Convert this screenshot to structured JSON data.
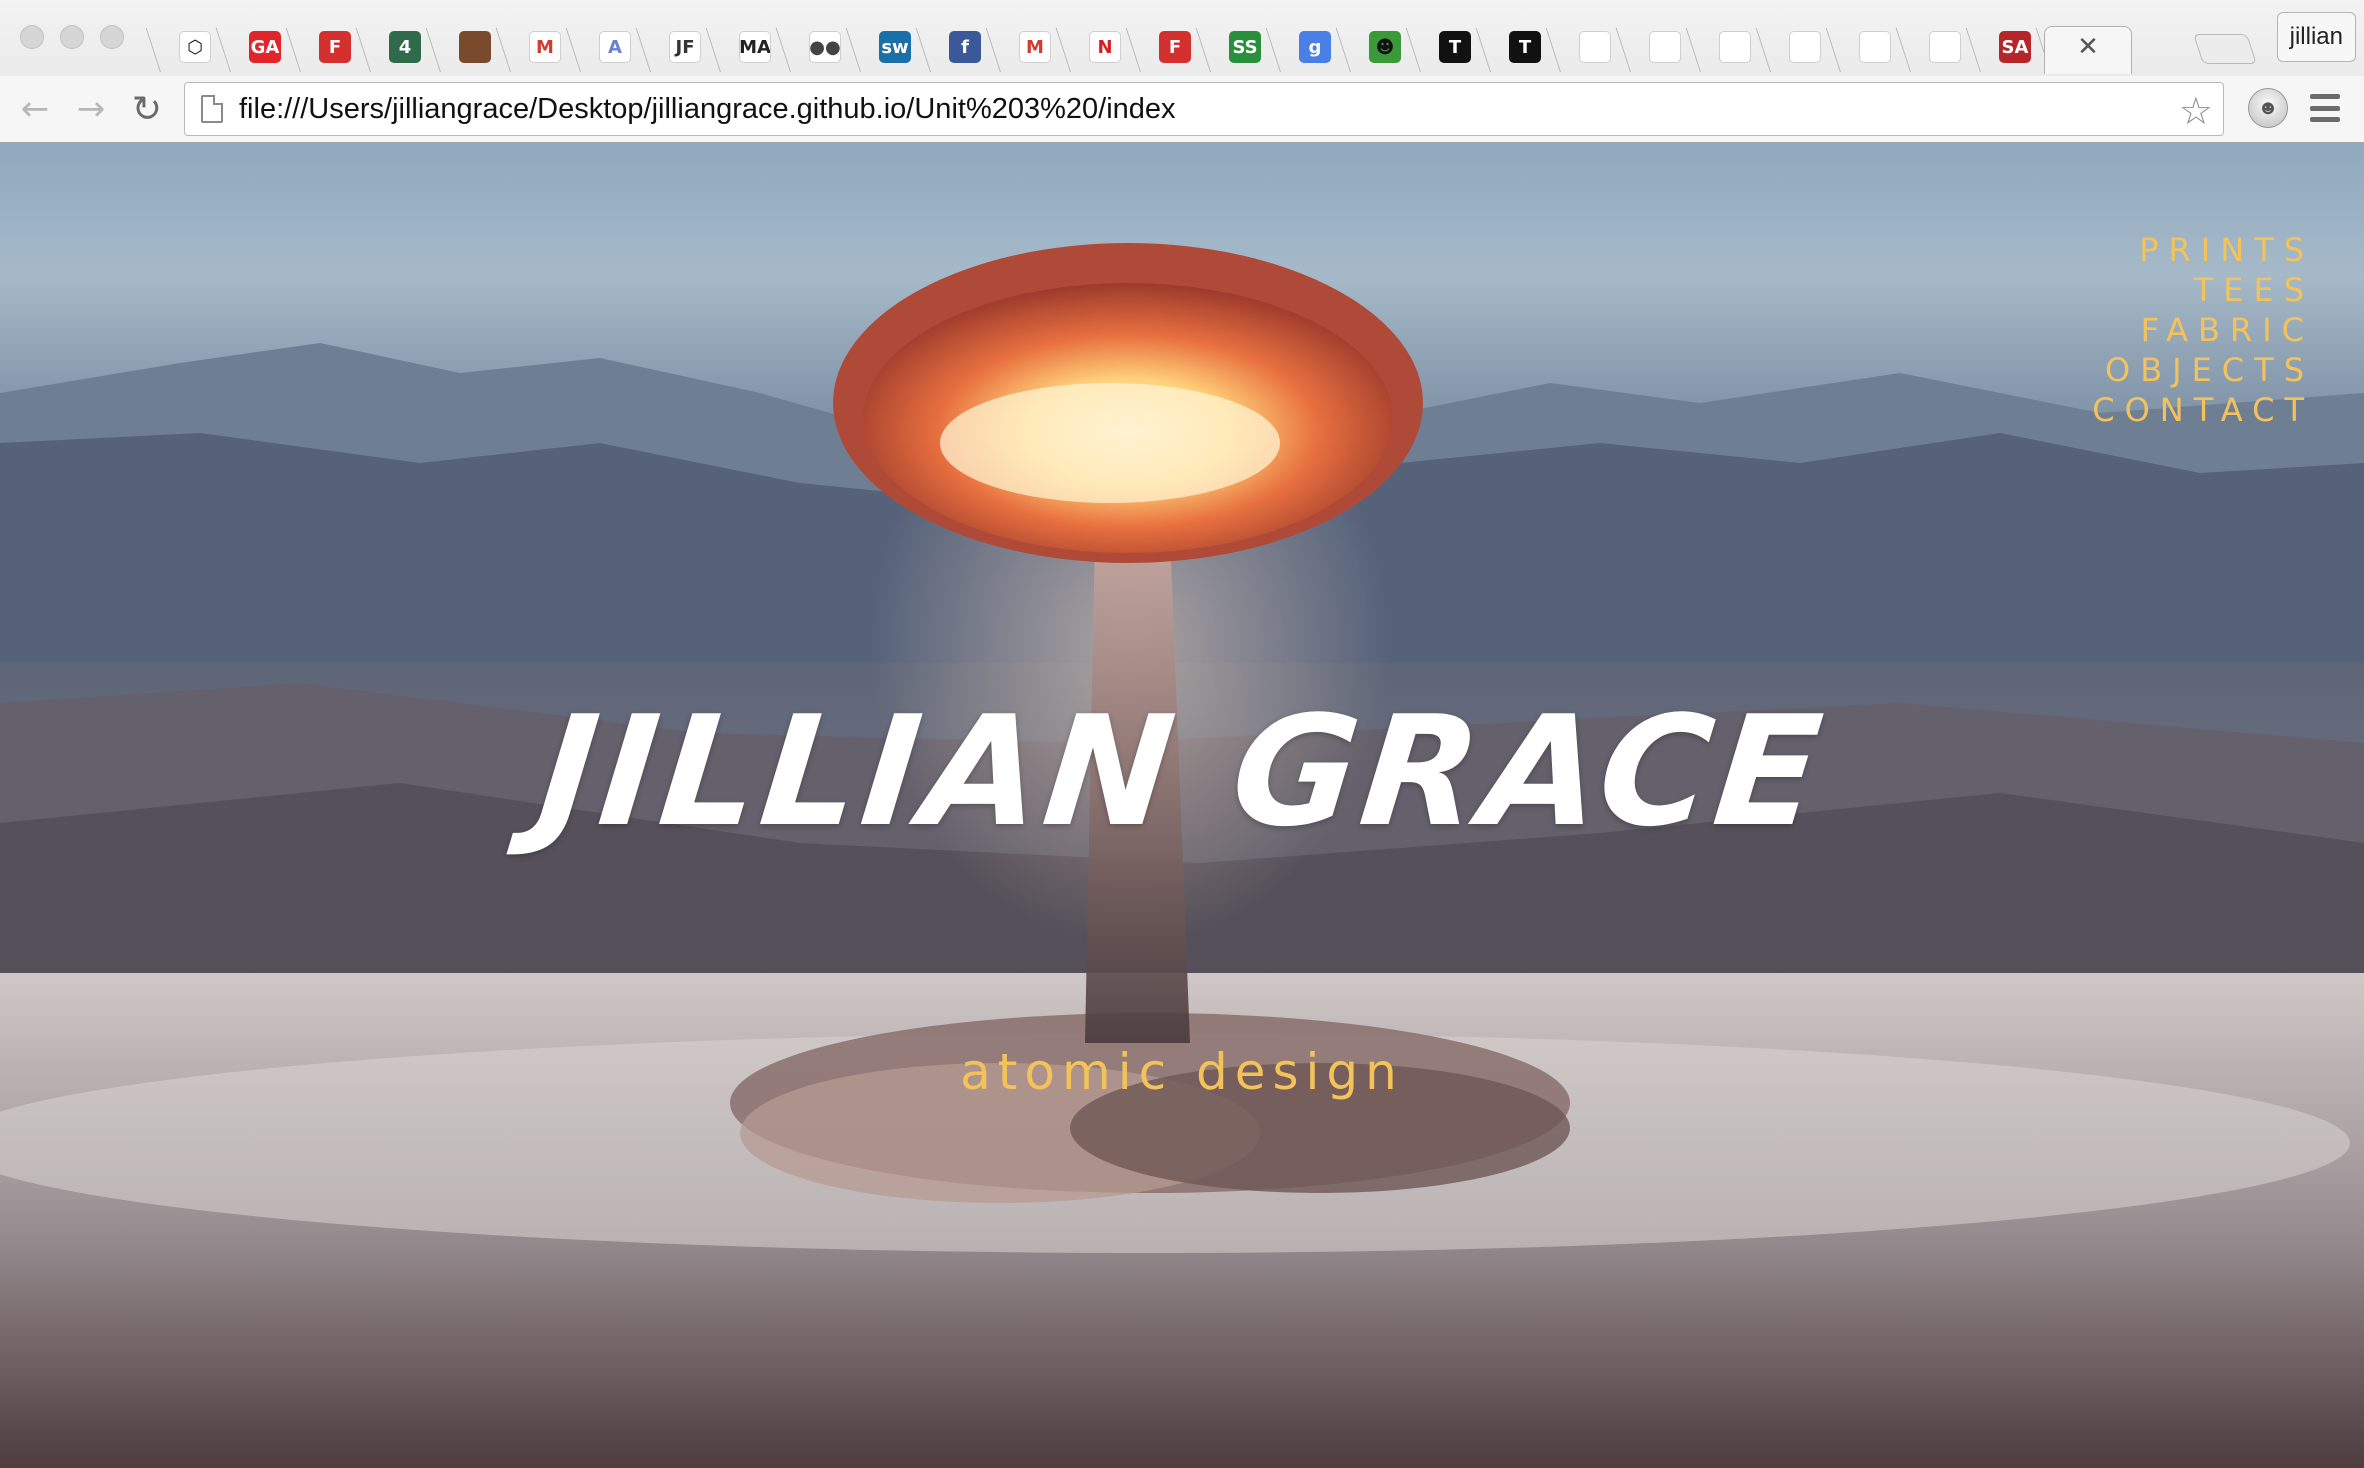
{
  "browser": {
    "tabs": [
      {
        "icon": "codepen-icon",
        "glyph": "⬡",
        "bg": "#ffffff",
        "fg": "#111111"
      },
      {
        "icon": "general-assembly-icon",
        "glyph": "GA",
        "bg": "#e0262b",
        "fg": "#ffffff"
      },
      {
        "icon": "fiveby-icon",
        "glyph": "F",
        "bg": "#d4302f",
        "fg": "#ffffff"
      },
      {
        "icon": "channel4-icon",
        "glyph": "4",
        "bg": "#2f6b4a",
        "fg": "#ffffff"
      },
      {
        "icon": "portrait-icon",
        "glyph": "",
        "bg": "#7a4a2c",
        "fg": "#ffffff"
      },
      {
        "icon": "gmail-icon",
        "glyph": "M",
        "bg": "#ffffff",
        "fg": "#d23b2f"
      },
      {
        "icon": "font-a-icon",
        "glyph": "A",
        "bg": "#ffffff",
        "fg": "#6b7fd6"
      },
      {
        "icon": "jf-icon",
        "glyph": "JF",
        "bg": "#ffffff",
        "fg": "#333333"
      },
      {
        "icon": "ma-icon",
        "glyph": "MA",
        "bg": "#ffffff",
        "fg": "#222222"
      },
      {
        "icon": "circles-icon",
        "glyph": "●●",
        "bg": "#ffffff",
        "fg": "#444444"
      },
      {
        "icon": "sw-icon",
        "glyph": "sw",
        "bg": "#1a6fa8",
        "fg": "#ffffff"
      },
      {
        "icon": "facebook-icon",
        "glyph": "f",
        "bg": "#3b5998",
        "fg": "#ffffff"
      },
      {
        "icon": "gmail-icon",
        "glyph": "M",
        "bg": "#ffffff",
        "fg": "#d23b2f"
      },
      {
        "icon": "netflix-icon",
        "glyph": "N",
        "bg": "#ffffff",
        "fg": "#d81f26"
      },
      {
        "icon": "fiveby-icon",
        "glyph": "F",
        "bg": "#d4302f",
        "fg": "#ffffff"
      },
      {
        "icon": "ss-icon",
        "glyph": "SS",
        "bg": "#2a8f3c",
        "fg": "#ffffff"
      },
      {
        "icon": "google-icon",
        "glyph": "g",
        "bg": "#4a7fe6",
        "fg": "#ffffff"
      },
      {
        "icon": "silhouette-icon",
        "glyph": "☻",
        "bg": "#3a9a3a",
        "fg": "#111111"
      },
      {
        "icon": "t-icon",
        "glyph": "T",
        "bg": "#111111",
        "fg": "#ffffff"
      },
      {
        "icon": "t-icon",
        "glyph": "T",
        "bg": "#111111",
        "fg": "#ffffff"
      },
      {
        "icon": "blank-page-icon",
        "glyph": "",
        "bg": "#ffffff",
        "fg": "#999999"
      },
      {
        "icon": "blank-page-icon",
        "glyph": "",
        "bg": "#ffffff",
        "fg": "#999999"
      },
      {
        "icon": "blank-page-icon",
        "glyph": "",
        "bg": "#ffffff",
        "fg": "#999999"
      },
      {
        "icon": "blank-page-icon",
        "glyph": "",
        "bg": "#ffffff",
        "fg": "#999999"
      },
      {
        "icon": "blank-page-icon",
        "glyph": "",
        "bg": "#ffffff",
        "fg": "#999999"
      },
      {
        "icon": "blank-page-icon",
        "glyph": "",
        "bg": "#ffffff",
        "fg": "#999999"
      },
      {
        "icon": "sa-icon",
        "glyph": "SA",
        "bg": "#b5262b",
        "fg": "#ffffff"
      }
    ],
    "active_tab_close": "✕",
    "profile_name": "jillian",
    "url": "file:///Users/jilliangrace/Desktop/jilliangrace.github.io/Unit%203%20/index",
    "back_icon": "←",
    "forward_icon": "→",
    "reload_icon": "↻",
    "star_icon": "☆"
  },
  "page": {
    "nav": [
      "PRINTS",
      "TEES",
      "FABRIC",
      "OBJECTS",
      "CONTACT"
    ],
    "title": "JILLIAN GRACE",
    "tagline": "atomic design",
    "colors": {
      "accent": "#f3c25a",
      "title": "#ffffff"
    }
  }
}
